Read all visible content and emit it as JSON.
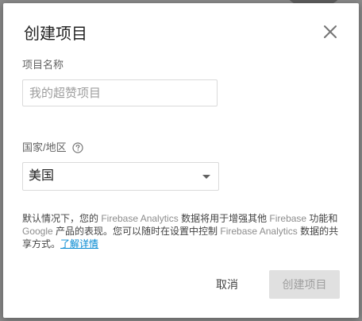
{
  "dialog": {
    "title": "创建项目",
    "close_icon": "close-icon"
  },
  "project_name": {
    "label": "项目名称",
    "placeholder": "我的超赞项目",
    "value": ""
  },
  "country": {
    "label": "国家/地区",
    "help_icon": "help-circle-icon",
    "selected": "美国",
    "dropdown_icon": "triangle-down-icon"
  },
  "notice": {
    "part1": "默认情况下，您的 ",
    "brand1": "Firebase Analytics",
    "part2": " 数据将用于增强其他 ",
    "brand2": "Firebase",
    "part3": " 功能和 ",
    "brand3": "Google",
    "part4": " 产品的表现。您可以随时在设置中控制 ",
    "brand4": "Firebase Analytics",
    "part5": " 数据的共享方式。",
    "link": "了解详情"
  },
  "actions": {
    "cancel": "取消",
    "create": "创建项目"
  },
  "colors": {
    "link": "#0288d1",
    "disabled_button_bg": "#e0e0e0",
    "disabled_button_text": "#9e9e9e"
  }
}
